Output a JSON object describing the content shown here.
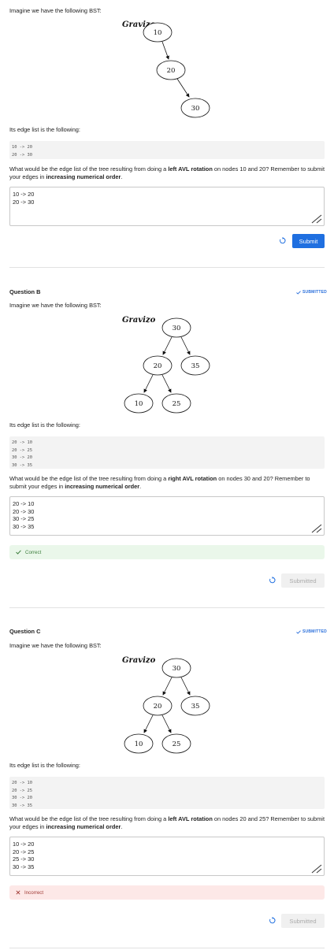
{
  "q1": {
    "intro": "Imagine we have the following BST:",
    "logo": "Gravizo",
    "nodes": [
      "10",
      "20",
      "30"
    ],
    "edge_intro": "Its edge list is the following:",
    "code": [
      "10 -> 20",
      "20 -> 30"
    ],
    "prompt_pre": "What would be the edge list of the tree resulting from doing a ",
    "prompt_bold": "left AVL rotation",
    "prompt_mid": " on nodes 10 and 20? Remember to submit your edges in ",
    "prompt_bold2": "increasing numerical order",
    "prompt_end": ".",
    "answer": "10 -> 20\n20 -> 30",
    "submit_label": "Submit"
  },
  "q2": {
    "title": "Question B",
    "status": "SUBMITTED",
    "intro": "Imagine we have the following BST:",
    "logo": "Gravizo",
    "nodes": [
      "30",
      "20",
      "35",
      "10",
      "25"
    ],
    "edge_intro": "Its edge list is the following:",
    "code": [
      "20 -> 10",
      "20 -> 25",
      "30 -> 20",
      "30 -> 35"
    ],
    "prompt_pre": "What would be the edge list of the tree resulting from doing a ",
    "prompt_bold": "right AVL rotation",
    "prompt_mid": " on nodes 30 and 20? Remember to submit your edges in ",
    "prompt_bold2": "increasing numerical order",
    "prompt_end": ".",
    "answer": "20 -> 10\n20 -> 30\n30 -> 25\n30 -> 35",
    "result": "Correct",
    "submit_label": "Submitted"
  },
  "q3": {
    "title": "Question C",
    "status": "SUBMITTED",
    "intro": "Imagine we have the following BST:",
    "logo": "Gravizo",
    "nodes": [
      "30",
      "20",
      "35",
      "10",
      "25"
    ],
    "edge_intro": "Its edge list is the following:",
    "code": [
      "20 -> 10",
      "20 -> 25",
      "30 -> 20",
      "30 -> 35"
    ],
    "prompt_pre": "What would be the edge list of the tree resulting from doing a ",
    "prompt_bold": "left AVL rotation",
    "prompt_mid": " on nodes 20 and 25? Remember to submit your edges in ",
    "prompt_bold2": "increasing numerical order",
    "prompt_end": ".",
    "answer": "10 -> 20\n20 -> 25\n25 -> 30\n30 -> 35",
    "result": "Incorrect",
    "submit_label": "Submitted"
  },
  "colors": {
    "accent": "#1f6fe0",
    "correct": "#3e7f3e",
    "incorrect": "#a03a35"
  }
}
